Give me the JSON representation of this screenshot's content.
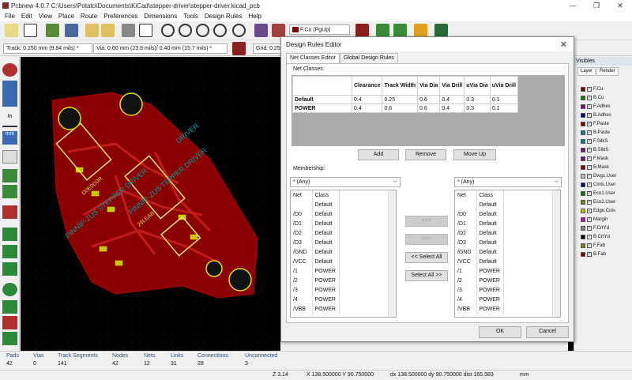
{
  "window": {
    "title": "Pcbnew 4.0.7 C:\\Users\\Potato\\Documents\\KiCad\\stepper-driver\\stepper-driver.kicad_pcb",
    "minimize": "—",
    "maximize": "❐",
    "close": "✕"
  },
  "menu": [
    "File",
    "Edit",
    "View",
    "Place",
    "Route",
    "Preferences",
    "Dimensions",
    "Tools",
    "Design Rules",
    "Help"
  ],
  "toolbar": {
    "layer_select": "F.Cu (PgUp)"
  },
  "toolbar2": {
    "track": "Track: 0.250 mm (9.84 mils) *",
    "via": "Via: 0.60 mm (23.6 mils)/ 0.40 mm (15.7 mils) *",
    "grid": "Grid: 0.250"
  },
  "layers_panel": {
    "header": "Visibles",
    "tabs": [
      "Layer",
      "Render"
    ],
    "items": [
      {
        "name": "F.Cu",
        "color": "#840000"
      },
      {
        "name": "B.Cu",
        "color": "#008400"
      },
      {
        "name": "F.Adhes",
        "color": "#840084"
      },
      {
        "name": "B.Adhes",
        "color": "#000084"
      },
      {
        "name": "F.Paste",
        "color": "#840000"
      },
      {
        "name": "B.Paste",
        "color": "#008484"
      },
      {
        "name": "F.SilkS",
        "color": "#008484"
      },
      {
        "name": "B.SilkS",
        "color": "#840084"
      },
      {
        "name": "F.Mask",
        "color": "#840084"
      },
      {
        "name": "B.Mask",
        "color": "#840000"
      },
      {
        "name": "Dwgs.User",
        "color": "#c2c2c2"
      },
      {
        "name": "Cmts.User",
        "color": "#000084"
      },
      {
        "name": "Eco1.User",
        "color": "#008400"
      },
      {
        "name": "Eco2.User",
        "color": "#848400"
      },
      {
        "name": "Edge.Cuts",
        "color": "#c2c200"
      },
      {
        "name": "Margin",
        "color": "#c200c2"
      },
      {
        "name": "F.CrtYd",
        "color": "#848484"
      },
      {
        "name": "B.CrtYd",
        "color": "#000000"
      },
      {
        "name": "F.Fab",
        "color": "#848400"
      },
      {
        "name": "B.Fab",
        "color": "#840000"
      }
    ]
  },
  "status": {
    "labels": [
      "Pads",
      "Vias",
      "Track Segments",
      "Nodes",
      "Nets",
      "Links",
      "Connections",
      "Unconnected"
    ],
    "values": [
      "42",
      "0",
      "141",
      "42",
      "12",
      "31",
      "28",
      "3"
    ]
  },
  "coords": {
    "zoom": "Z 3.14",
    "xy": "X 138.500000  Y 90.750000",
    "dxy": "dx 138.500000  dy 90.750000  dist 165.583",
    "units": "mm"
  },
  "dialog": {
    "title": "Design Rules Editor",
    "close": "✕",
    "tabs": [
      "Net Classes Editor",
      "Global Design Rules"
    ],
    "net_classes_label": "Net Classes:",
    "columns": [
      "Clearance",
      "Track Width",
      "Via Dia",
      "Via Drill",
      "uVia Dia",
      "uVia Drill"
    ],
    "rows": [
      {
        "name": "Default",
        "values": [
          "0.4",
          "0.25",
          "0.6",
          "0.4",
          "0.3",
          "0.1"
        ]
      },
      {
        "name": "POWER",
        "values": [
          "0.4",
          "0.6",
          "0.6",
          "0.4",
          "0.3",
          "0.1"
        ]
      }
    ],
    "buttons": {
      "add": "Add",
      "remove": "Remove",
      "move_up": "Move Up"
    },
    "membership_label": "Membership:",
    "left_filter": "* (Any)",
    "right_filter": "* (Any)",
    "list_headers": [
      "Net",
      "Class"
    ],
    "nets": [
      {
        "net": "",
        "cls": "Default"
      },
      {
        "net": "/D0",
        "cls": "Default"
      },
      {
        "net": "/D1",
        "cls": "Default"
      },
      {
        "net": "/D2",
        "cls": "Default"
      },
      {
        "net": "/D3",
        "cls": "Default"
      },
      {
        "net": "/GND",
        "cls": "Default"
      },
      {
        "net": "/VCC",
        "cls": "Default"
      },
      {
        "net": "/1",
        "cls": "POWER"
      },
      {
        "net": "/2",
        "cls": "POWER"
      },
      {
        "net": "/3",
        "cls": "POWER"
      },
      {
        "net": "/4",
        "cls": "POWER"
      },
      {
        "net": "/VBB",
        "cls": "POWER"
      }
    ],
    "move_buttons": {
      "left": "<<<",
      "right": ">>>",
      "select_all_left": "<< Select All",
      "select_all_right": "Select All >>"
    },
    "ok": "OK",
    "cancel": "Cancel"
  }
}
